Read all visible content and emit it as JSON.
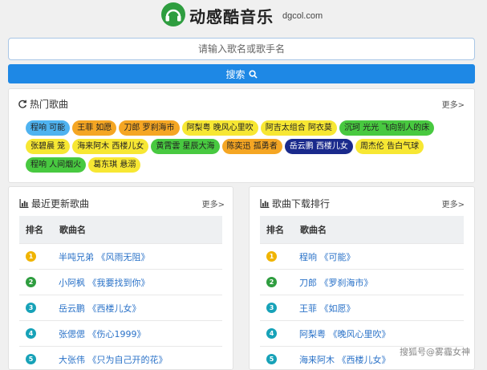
{
  "header": {
    "title": "动感酷音乐",
    "domain": "dgcol.com",
    "logo_icon": "headphones-icon"
  },
  "search": {
    "placeholder": "请输入歌名或歌手名",
    "button_label": "搜索"
  },
  "hot": {
    "title": "热门歌曲",
    "more": "更多",
    "tags": [
      {
        "label": "程响 可能",
        "color": "#4fb3f0"
      },
      {
        "label": "王菲 如愿",
        "color": "#f5a623"
      },
      {
        "label": "刀郎 罗刹海市",
        "color": "#f5a623"
      },
      {
        "label": "阿梨粤 晚风心里吹",
        "color": "#f7e733"
      },
      {
        "label": "阿吉太组合 阿衣莫",
        "color": "#f7e733"
      },
      {
        "label": "沉珂 光光 飞向别人的床",
        "color": "#48c940"
      },
      {
        "label": "张碧晨 笼",
        "color": "#f7e733"
      },
      {
        "label": "海来阿木 西楼儿女",
        "color": "#f7e733"
      },
      {
        "label": "黄霄雲 星辰大海",
        "color": "#48c940"
      },
      {
        "label": "陈奕迅 孤勇者",
        "color": "#f5a623"
      },
      {
        "label": "岳云鹏 西楼儿女",
        "color": "#1a2a8c",
        "text": "#ffffff"
      },
      {
        "label": "周杰伦 告白气球",
        "color": "#f7e733"
      },
      {
        "label": "程响 人间烟火",
        "color": "#48c940"
      },
      {
        "label": "葛东琪 悬溺",
        "color": "#f7e733"
      }
    ]
  },
  "recent": {
    "title": "最近更新歌曲",
    "more": "更多",
    "col_rank": "排名",
    "col_name": "歌曲名",
    "rows": [
      {
        "rank": "1",
        "name": "半吨兄弟 《风雨无阻》"
      },
      {
        "rank": "2",
        "name": "小阿枫 《我要找到你》"
      },
      {
        "rank": "3",
        "name": "岳云鹏 《西楼儿女》"
      },
      {
        "rank": "4",
        "name": "张偲偲 《伤心1999》"
      },
      {
        "rank": "5",
        "name": "大张伟 《只为自己开的花》"
      }
    ]
  },
  "ranking": {
    "title": "歌曲下载排行",
    "more": "更多",
    "col_rank": "排名",
    "col_name": "歌曲名",
    "rows": [
      {
        "rank": "1",
        "name": "程响 《可能》"
      },
      {
        "rank": "2",
        "name": "刀郎 《罗刹海市》"
      },
      {
        "rank": "3",
        "name": "王菲 《如愿》"
      },
      {
        "rank": "4",
        "name": "阿梨粤 《晚风心里吹》"
      },
      {
        "rank": "5",
        "name": "海来阿木 《西楼儿女》"
      }
    ]
  },
  "watermark": "搜狐号@雾霾女神"
}
